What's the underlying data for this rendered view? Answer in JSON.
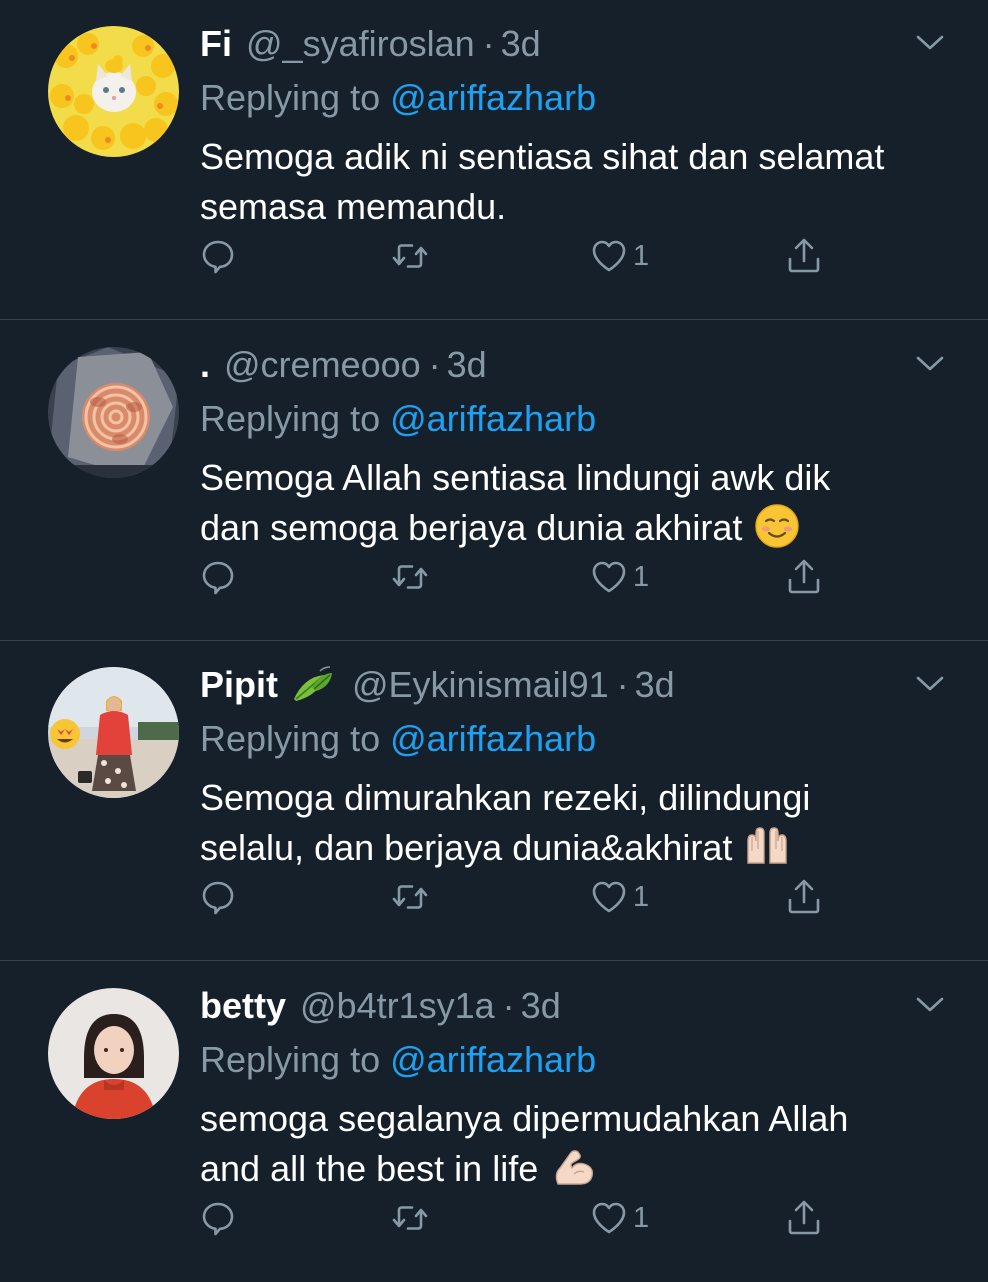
{
  "colors": {
    "background": "#15202b",
    "text": "#ffffff",
    "secondary": "#8899a6",
    "link": "#1da1f2",
    "divider": "#38444d"
  },
  "tweets": [
    {
      "name": "Fi",
      "name_emoji": null,
      "handle": "@_syafiroslan",
      "separator": "·",
      "time": "3d",
      "replying_prefix": "Replying to ",
      "replying_to": "@ariffazharb",
      "text_lines": [
        "Semoga adik ni sentiasa sihat dan selamat",
        "semasa memandu."
      ],
      "text_emoji": null,
      "like_count": "1",
      "avatar": "cat-with-rubber-ducks"
    },
    {
      "name": ".",
      "name_emoji": null,
      "handle": "@cremeooo",
      "separator": "·",
      "time": "3d",
      "replying_prefix": "Replying to ",
      "replying_to": "@ariffazharb",
      "text_lines": [
        "Semoga Allah sentiasa lindungi awk dik",
        "dan semoga berjaya dunia akhirat"
      ],
      "text_emoji": "smiling-face-emoji",
      "like_count": "1",
      "avatar": "rose-bouquet"
    },
    {
      "name": "Pipit",
      "name_emoji": "leaves-emoji",
      "handle": "@Eykinismail91",
      "separator": "·",
      "time": "3d",
      "replying_prefix": "Replying to ",
      "replying_to": "@ariffazharb",
      "text_lines": [
        "Semoga dimurahkan rezeki, dilindungi",
        "selalu, dan berjaya dunia&akhirat"
      ],
      "text_emoji": "palms-up-emoji",
      "like_count": "1",
      "avatar": "woman-on-beach"
    },
    {
      "name": "betty",
      "name_emoji": null,
      "handle": "@b4tr1sy1a",
      "separator": "·",
      "time": "3d",
      "replying_prefix": "Replying to ",
      "replying_to": "@ariffazharb",
      "text_lines": [
        "semoga segalanya dipermudahkan Allah",
        "and all the best in life"
      ],
      "text_emoji": "flexed-biceps-emoji",
      "like_count": "1",
      "avatar": "girl-portrait"
    }
  ]
}
